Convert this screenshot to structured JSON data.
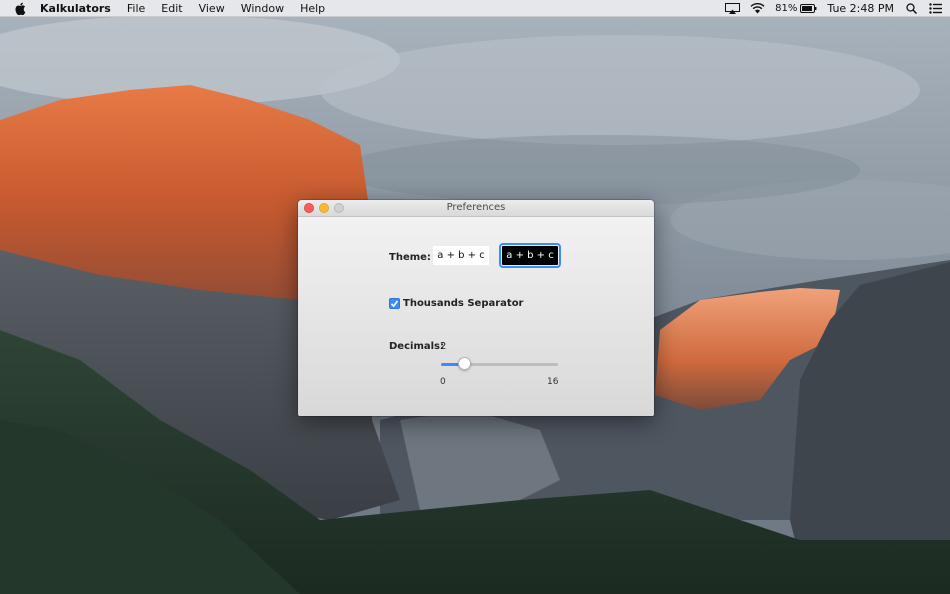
{
  "menubar": {
    "app_name": "Kalkulators",
    "menus": [
      "File",
      "Edit",
      "View",
      "Window",
      "Help"
    ],
    "status": {
      "battery_percent": "81%",
      "clock": "Tue 2:48 PM"
    }
  },
  "window": {
    "title": "Preferences",
    "theme": {
      "label": "Theme:",
      "options": [
        {
          "text": "a + b + c",
          "style": "light",
          "selected": false
        },
        {
          "text": "a + b + c",
          "style": "dark",
          "selected": true
        }
      ]
    },
    "thousands_separator": {
      "label": "Thousands Separator",
      "checked": true
    },
    "decimals": {
      "label": "Decimals:",
      "value": "2",
      "slider": {
        "min": 0,
        "max": 16,
        "value": 2,
        "min_label": "0",
        "max_label": "16"
      }
    }
  },
  "colors": {
    "accent": "#3b8cf6",
    "close": "#fc5f57",
    "minimize": "#fdbc2e",
    "zoom_disabled": "#d0d0d0"
  },
  "icons": [
    "apple-icon",
    "airplay-icon",
    "wifi-icon",
    "battery-icon",
    "spotlight-icon",
    "notification-center-icon",
    "checkmark-icon"
  ]
}
